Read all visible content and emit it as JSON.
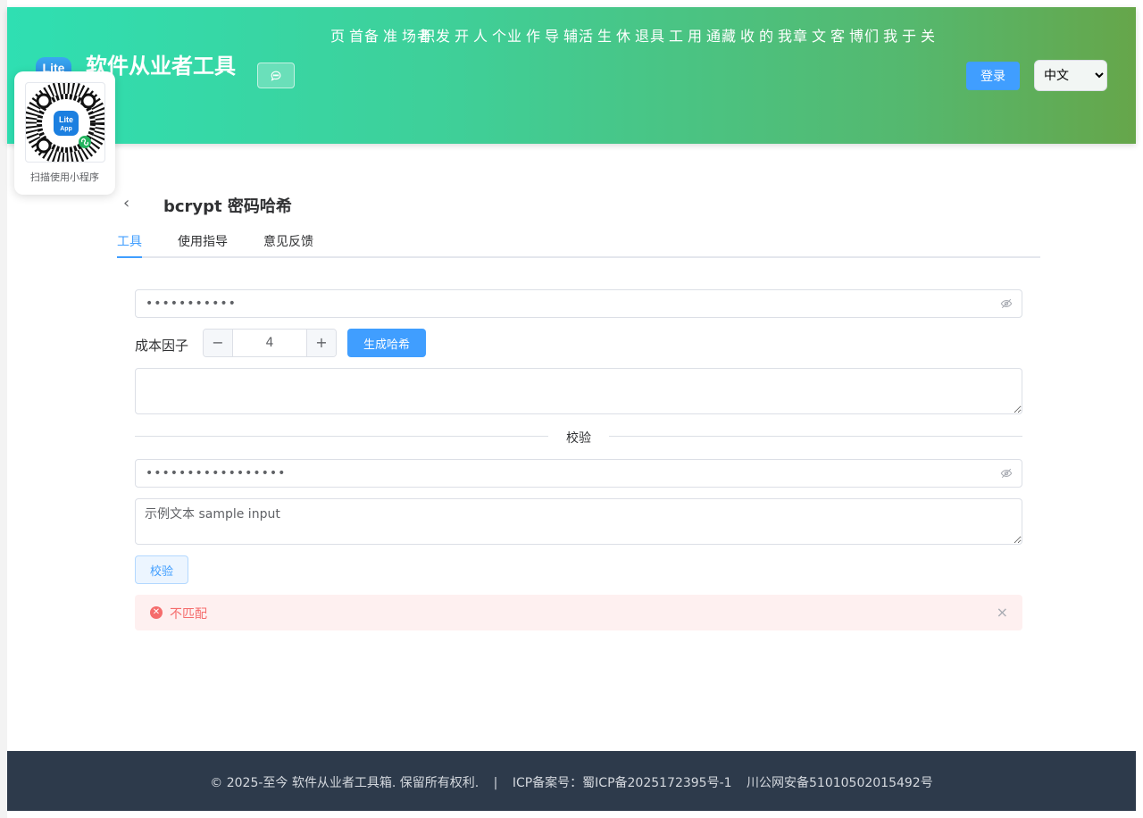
{
  "header": {
    "logo_text": "Lite",
    "site_title": "软件从业者工具",
    "chat_icon": "chat-bubble-icon",
    "nav": [
      {
        "label": "首页"
      },
      {
        "label": "职场准备"
      },
      {
        "label": "个人开发者"
      },
      {
        "label": "辅导作业"
      },
      {
        "label": "退休生活"
      },
      {
        "label": "通用工具"
      },
      {
        "label": "我的收藏"
      },
      {
        "label": "博客文章"
      },
      {
        "label": "关于我们"
      }
    ],
    "login_label": "登录",
    "language": {
      "selected": "中文",
      "options": [
        "中文"
      ]
    }
  },
  "qr": {
    "caption": "扫描使用小程序",
    "logo_line1": "Lite",
    "logo_line2": "App"
  },
  "page": {
    "title": "bcrypt 密码哈希",
    "tabs": [
      {
        "label": "工具",
        "active": true
      },
      {
        "label": "使用指导",
        "active": false
      },
      {
        "label": "意见反馈",
        "active": false
      }
    ]
  },
  "hash_section": {
    "password_value": "•••••••••••",
    "cost_label": "成本因子",
    "cost_value": "4",
    "minus_symbol": "−",
    "plus_symbol": "+",
    "generate_label": "生成哈希",
    "hash_output": ""
  },
  "verify_section": {
    "divider_label": "校验",
    "password_value": "•••••••••••••••••",
    "hash_input": "示例文本 sample input",
    "verify_label": "校验",
    "result_text": "不匹配",
    "close_symbol": "×"
  },
  "footer": {
    "copyright": "© 2025-至今 软件从业者工具箱. 保留所有权利.",
    "separator": "|",
    "icp": "ICP备案号：蜀ICP备2025172395号-1",
    "police": "川公网安备51010502015492号"
  },
  "colors": {
    "primary": "#409eff",
    "header_gradient_start": "#2fdfb2",
    "header_gradient_end": "#66a64a",
    "error": "#f56c6c",
    "footer_bg": "#2d3a4b"
  }
}
